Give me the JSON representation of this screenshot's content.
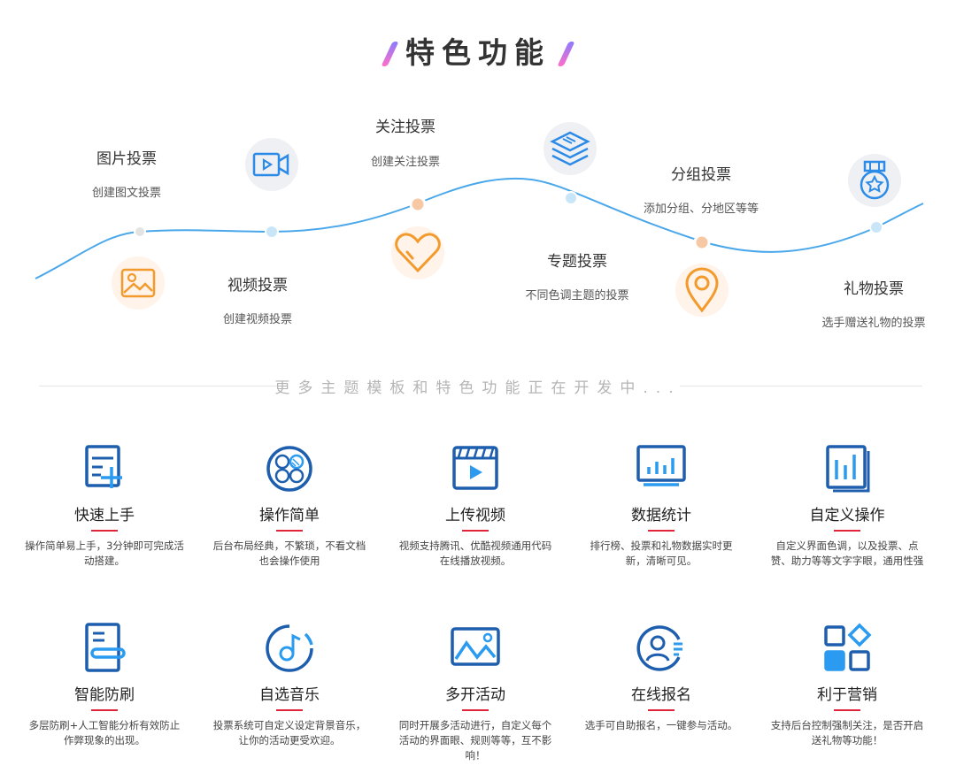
{
  "header": {
    "title": "特色功能"
  },
  "timeline": [
    {
      "title": "图片投票",
      "desc": "创建图文投票",
      "icon": "image-icon"
    },
    {
      "title": "视频投票",
      "desc": "创建视频投票",
      "icon": "video-icon"
    },
    {
      "title": "关注投票",
      "desc": "创建关注投票",
      "icon": "heart-icon"
    },
    {
      "title": "专题投票",
      "desc": "不同色调主题的投票",
      "icon": "layers-icon"
    },
    {
      "title": "分组投票",
      "desc": "添加分组、分地区等等",
      "icon": "location-pin-icon"
    },
    {
      "title": "礼物投票",
      "desc": "选手赠送礼物的投票",
      "icon": "medal-icon"
    }
  ],
  "subtitle": "更多主题模板和特色功能正在开发中...",
  "features": [
    {
      "title": "快速上手",
      "desc": "操作简单易上手，3分钟即可完成活动搭建。",
      "icon": "quick-start-icon"
    },
    {
      "title": "操作简单",
      "desc": "后台布局经典，不繁琐，不看文档也会操作使用",
      "icon": "grid-circle-icon"
    },
    {
      "title": "上传视频",
      "desc": "视频支持腾讯、优酷视频通用代码在线播放视频。",
      "icon": "video-upload-icon"
    },
    {
      "title": "数据统计",
      "desc": "排行榜、投票和礼物数据实时更新，清晰可见。",
      "icon": "monitor-chart-icon"
    },
    {
      "title": "自定义操作",
      "desc": "自定义界面色调，以及投票、点赞、助力等等文字字眼，通用性强",
      "icon": "custom-bars-icon"
    },
    {
      "title": "智能防刷",
      "desc": "多层防刷+人工智能分析有效防止作弊现象的出现。",
      "icon": "anti-fraud-icon"
    },
    {
      "title": "自选音乐",
      "desc": "投票系统可自定义设定背景音乐，让你的活动更受欢迎。",
      "icon": "music-icon"
    },
    {
      "title": "多开活动",
      "desc": "同时开展多活动进行，自定义每个活动的界面眼、规则等等，互不影响！",
      "icon": "landscape-icon"
    },
    {
      "title": "在线报名",
      "desc": "选手可自助报名，一键参与活动。",
      "icon": "user-signup-icon"
    },
    {
      "title": "利于营销",
      "desc": "支持后台控制强制关注，是否开启送礼物等功能！",
      "icon": "marketing-blocks-icon"
    }
  ]
}
